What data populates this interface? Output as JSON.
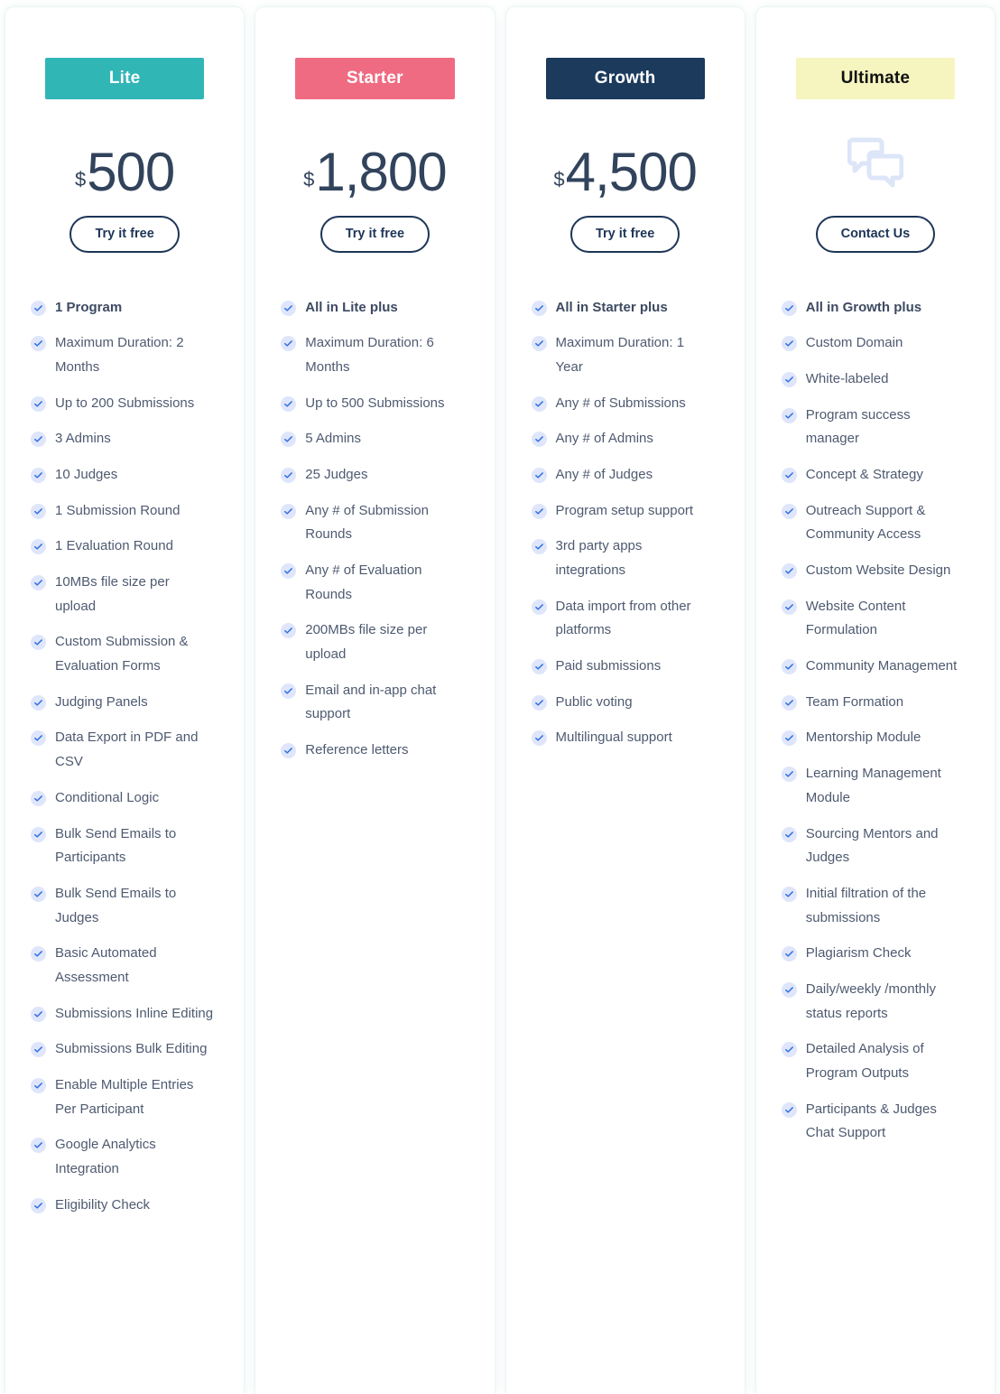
{
  "plans": [
    {
      "name": "Lite",
      "badge_bg": "#31b6b6",
      "badge_color": "#ffffff",
      "currency": "$",
      "price": "500",
      "cta_label": "Try it free",
      "has_price": true,
      "icon": "",
      "features": [
        {
          "text": "1 Program",
          "bold": true
        },
        {
          "text": "Maximum Duration: 2 Months",
          "bold": false
        },
        {
          "text": "Up to 200 Submissions",
          "bold": false
        },
        {
          "text": "3 Admins",
          "bold": false
        },
        {
          "text": "10 Judges",
          "bold": false
        },
        {
          "text": "1 Submission Round",
          "bold": false
        },
        {
          "text": "1 Evaluation Round",
          "bold": false
        },
        {
          "text": "10MBs file size per upload",
          "bold": false
        },
        {
          "text": "Custom Submission & Evaluation Forms",
          "bold": false
        },
        {
          "text": "Judging Panels",
          "bold": false
        },
        {
          "text": "Data Export in PDF and CSV",
          "bold": false
        },
        {
          "text": "Conditional Logic",
          "bold": false
        },
        {
          "text": "Bulk Send Emails to Participants",
          "bold": false
        },
        {
          "text": "Bulk Send Emails to Judges",
          "bold": false
        },
        {
          "text": "Basic Automated Assessment",
          "bold": false
        },
        {
          "text": "Submissions Inline Editing",
          "bold": false
        },
        {
          "text": "Submissions Bulk Editing",
          "bold": false
        },
        {
          "text": "Enable Multiple Entries Per Participant",
          "bold": false
        },
        {
          "text": "Google Analytics Integration",
          "bold": false
        },
        {
          "text": "Eligibility Check",
          "bold": false
        }
      ]
    },
    {
      "name": "Starter",
      "badge_bg": "#ef6b82",
      "badge_color": "#ffffff",
      "currency": "$",
      "price": "1,800",
      "cta_label": "Try it free",
      "has_price": true,
      "icon": "",
      "features": [
        {
          "text": "All in Lite plus",
          "bold": true
        },
        {
          "text": "Maximum Duration: 6 Months",
          "bold": false
        },
        {
          "text": "Up to 500 Submissions",
          "bold": false
        },
        {
          "text": "5 Admins",
          "bold": false
        },
        {
          "text": "25 Judges",
          "bold": false
        },
        {
          "text": "Any # of Submission Rounds",
          "bold": false
        },
        {
          "text": "Any # of Evaluation Rounds",
          "bold": false
        },
        {
          "text": "200MBs file size per upload",
          "bold": false
        },
        {
          "text": "Email and in-app chat support",
          "bold": false
        },
        {
          "text": "Reference letters",
          "bold": false
        }
      ]
    },
    {
      "name": "Growth",
      "badge_bg": "#1b3a5c",
      "badge_color": "#ffffff",
      "currency": "$",
      "price": "4,500",
      "cta_label": "Try it free",
      "has_price": true,
      "icon": "",
      "features": [
        {
          "text": "All in Starter plus",
          "bold": true
        },
        {
          "text": "Maximum Duration: 1 Year",
          "bold": false
        },
        {
          "text": "Any # of Submissions",
          "bold": false
        },
        {
          "text": "Any # of Admins",
          "bold": false
        },
        {
          "text": "Any # of Judges",
          "bold": false
        },
        {
          "text": "Program setup support",
          "bold": false
        },
        {
          "text": "3rd party apps integrations",
          "bold": false
        },
        {
          "text": "Data import from other platforms",
          "bold": false
        },
        {
          "text": "Paid submissions",
          "bold": false
        },
        {
          "text": "Public voting",
          "bold": false
        },
        {
          "text": "Multilingual support",
          "bold": false
        }
      ]
    },
    {
      "name": "Ultimate",
      "badge_bg": "#f6f5c0",
      "badge_color": "#111111",
      "currency": "",
      "price": "",
      "cta_label": "Contact Us",
      "has_price": false,
      "icon": "chat-bubbles-icon",
      "features": [
        {
          "text": "All in Growth plus",
          "bold": true
        },
        {
          "text": "Custom Domain",
          "bold": false
        },
        {
          "text": "White-labeled",
          "bold": false
        },
        {
          "text": "Program success manager",
          "bold": false
        },
        {
          "text": "Concept & Strategy",
          "bold": false
        },
        {
          "text": "Outreach Support & Community Access",
          "bold": false
        },
        {
          "text": "Custom Website Design",
          "bold": false
        },
        {
          "text": "Website Content Formulation",
          "bold": false
        },
        {
          "text": "Community Management",
          "bold": false
        },
        {
          "text": "Team Formation",
          "bold": false
        },
        {
          "text": "Mentorship Module",
          "bold": false
        },
        {
          "text": "Learning Management Module",
          "bold": false
        },
        {
          "text": "Sourcing Mentors and Judges",
          "bold": false
        },
        {
          "text": "Initial filtration of the submissions",
          "bold": false
        },
        {
          "text": "Plagiarism Check",
          "bold": false
        },
        {
          "text": "Daily/weekly /monthly status reports",
          "bold": false
        },
        {
          "text": "Detailed Analysis of Program Outputs",
          "bold": false
        },
        {
          "text": "Participants & Judges Chat Support",
          "bold": false
        }
      ]
    }
  ],
  "theme": {
    "check_circle_color": "#dfe6fb",
    "check_mark_color": "#2f6fe0",
    "text_color": "#4e5a70",
    "price_color": "#32435c",
    "cta_border_color": "#1d3557",
    "chat_icon_color": "#dde5f8"
  }
}
